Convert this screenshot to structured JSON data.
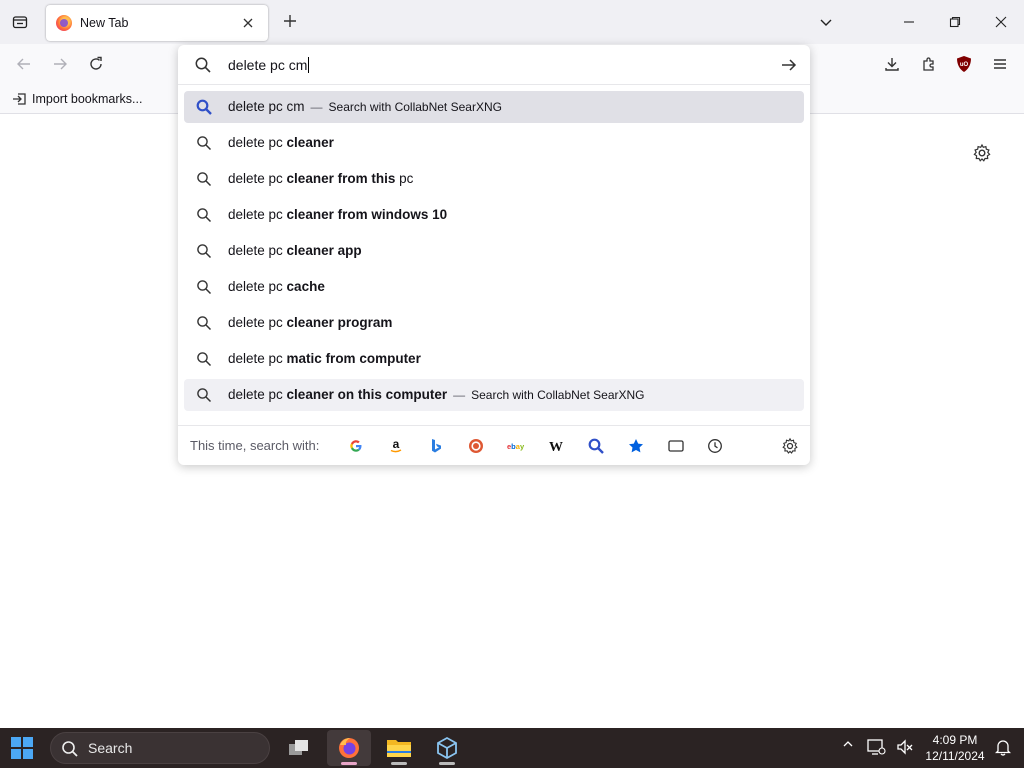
{
  "tab": {
    "title": "New Tab"
  },
  "bookmarks": {
    "import_label": "Import bookmarks..."
  },
  "urlbar": {
    "value": "delete pc cm"
  },
  "suggestions": [
    {
      "typed": "delete pc cm",
      "completion": "",
      "action_separator": "—",
      "action": "Search with CollabNet SearXNG",
      "highlight": "selected"
    },
    {
      "typed": "delete pc ",
      "completion": "cleaner",
      "rest": ""
    },
    {
      "typed": "delete pc ",
      "completion": "cleaner from this",
      "rest": " pc"
    },
    {
      "typed": "delete pc ",
      "completion": "cleaner from windows 10",
      "rest": ""
    },
    {
      "typed": "delete pc ",
      "completion": "cleaner app",
      "rest": ""
    },
    {
      "typed": "delete pc ",
      "completion": "cache",
      "rest": ""
    },
    {
      "typed": "delete pc ",
      "completion": "cleaner program",
      "rest": ""
    },
    {
      "typed": "delete pc ",
      "completion": "matic from computer",
      "rest": ""
    },
    {
      "typed": "delete pc ",
      "completion": "cleaner on this computer",
      "action_separator": "—",
      "action": "Search with CollabNet SearXNG",
      "highlight": "hover"
    }
  ],
  "oneoff": {
    "label": "This time, search with:",
    "engines": [
      {
        "name": "google-icon",
        "glyph": "G",
        "color": "#4285f4"
      },
      {
        "name": "amazon-icon",
        "glyph": "a",
        "color": "#111111"
      },
      {
        "name": "bing-icon",
        "glyph": "b",
        "color": "#2a7de1"
      },
      {
        "name": "duckduckgo-icon",
        "glyph": "D",
        "color": "#de5833"
      },
      {
        "name": "ebay-icon",
        "glyph": "ebay",
        "color": "#e53238"
      },
      {
        "name": "wikipedia-icon",
        "glyph": "W",
        "color": "#111111"
      },
      {
        "name": "searxng-icon",
        "glyph": "",
        "color": "#3050c8"
      },
      {
        "name": "bookmarks-icon",
        "glyph": "★",
        "color": "#0060df"
      },
      {
        "name": "tabs-icon",
        "glyph": "",
        "color": "#333333"
      },
      {
        "name": "history-icon",
        "glyph": "",
        "color": "#333333"
      }
    ]
  },
  "taskbar": {
    "search_label": "Search",
    "time": "4:09 PM",
    "date": "12/11/2024"
  }
}
